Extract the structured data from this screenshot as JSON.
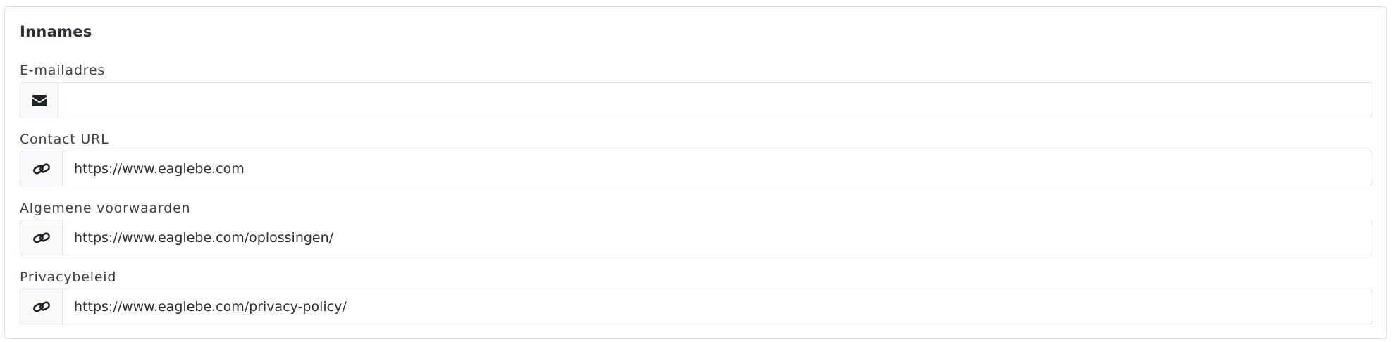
{
  "section": {
    "title": "Innames"
  },
  "fields": {
    "email": {
      "label": "E-mailadres",
      "value": "",
      "icon": "envelope-icon"
    },
    "contact_url": {
      "label": "Contact URL",
      "value": "https://www.eaglebe.com",
      "icon": "link-icon"
    },
    "terms": {
      "label": "Algemene voorwaarden",
      "value": "https://www.eaglebe.com/oplossingen/",
      "icon": "link-icon"
    },
    "privacy": {
      "label": "Privacybeleid",
      "value": "https://www.eaglebe.com/privacy-policy/",
      "icon": "link-icon"
    }
  },
  "colors": {
    "border": "#dee2e6",
    "addon_bg": "#f8f9fa",
    "text": "#2b2f33",
    "icon": "#212529"
  }
}
